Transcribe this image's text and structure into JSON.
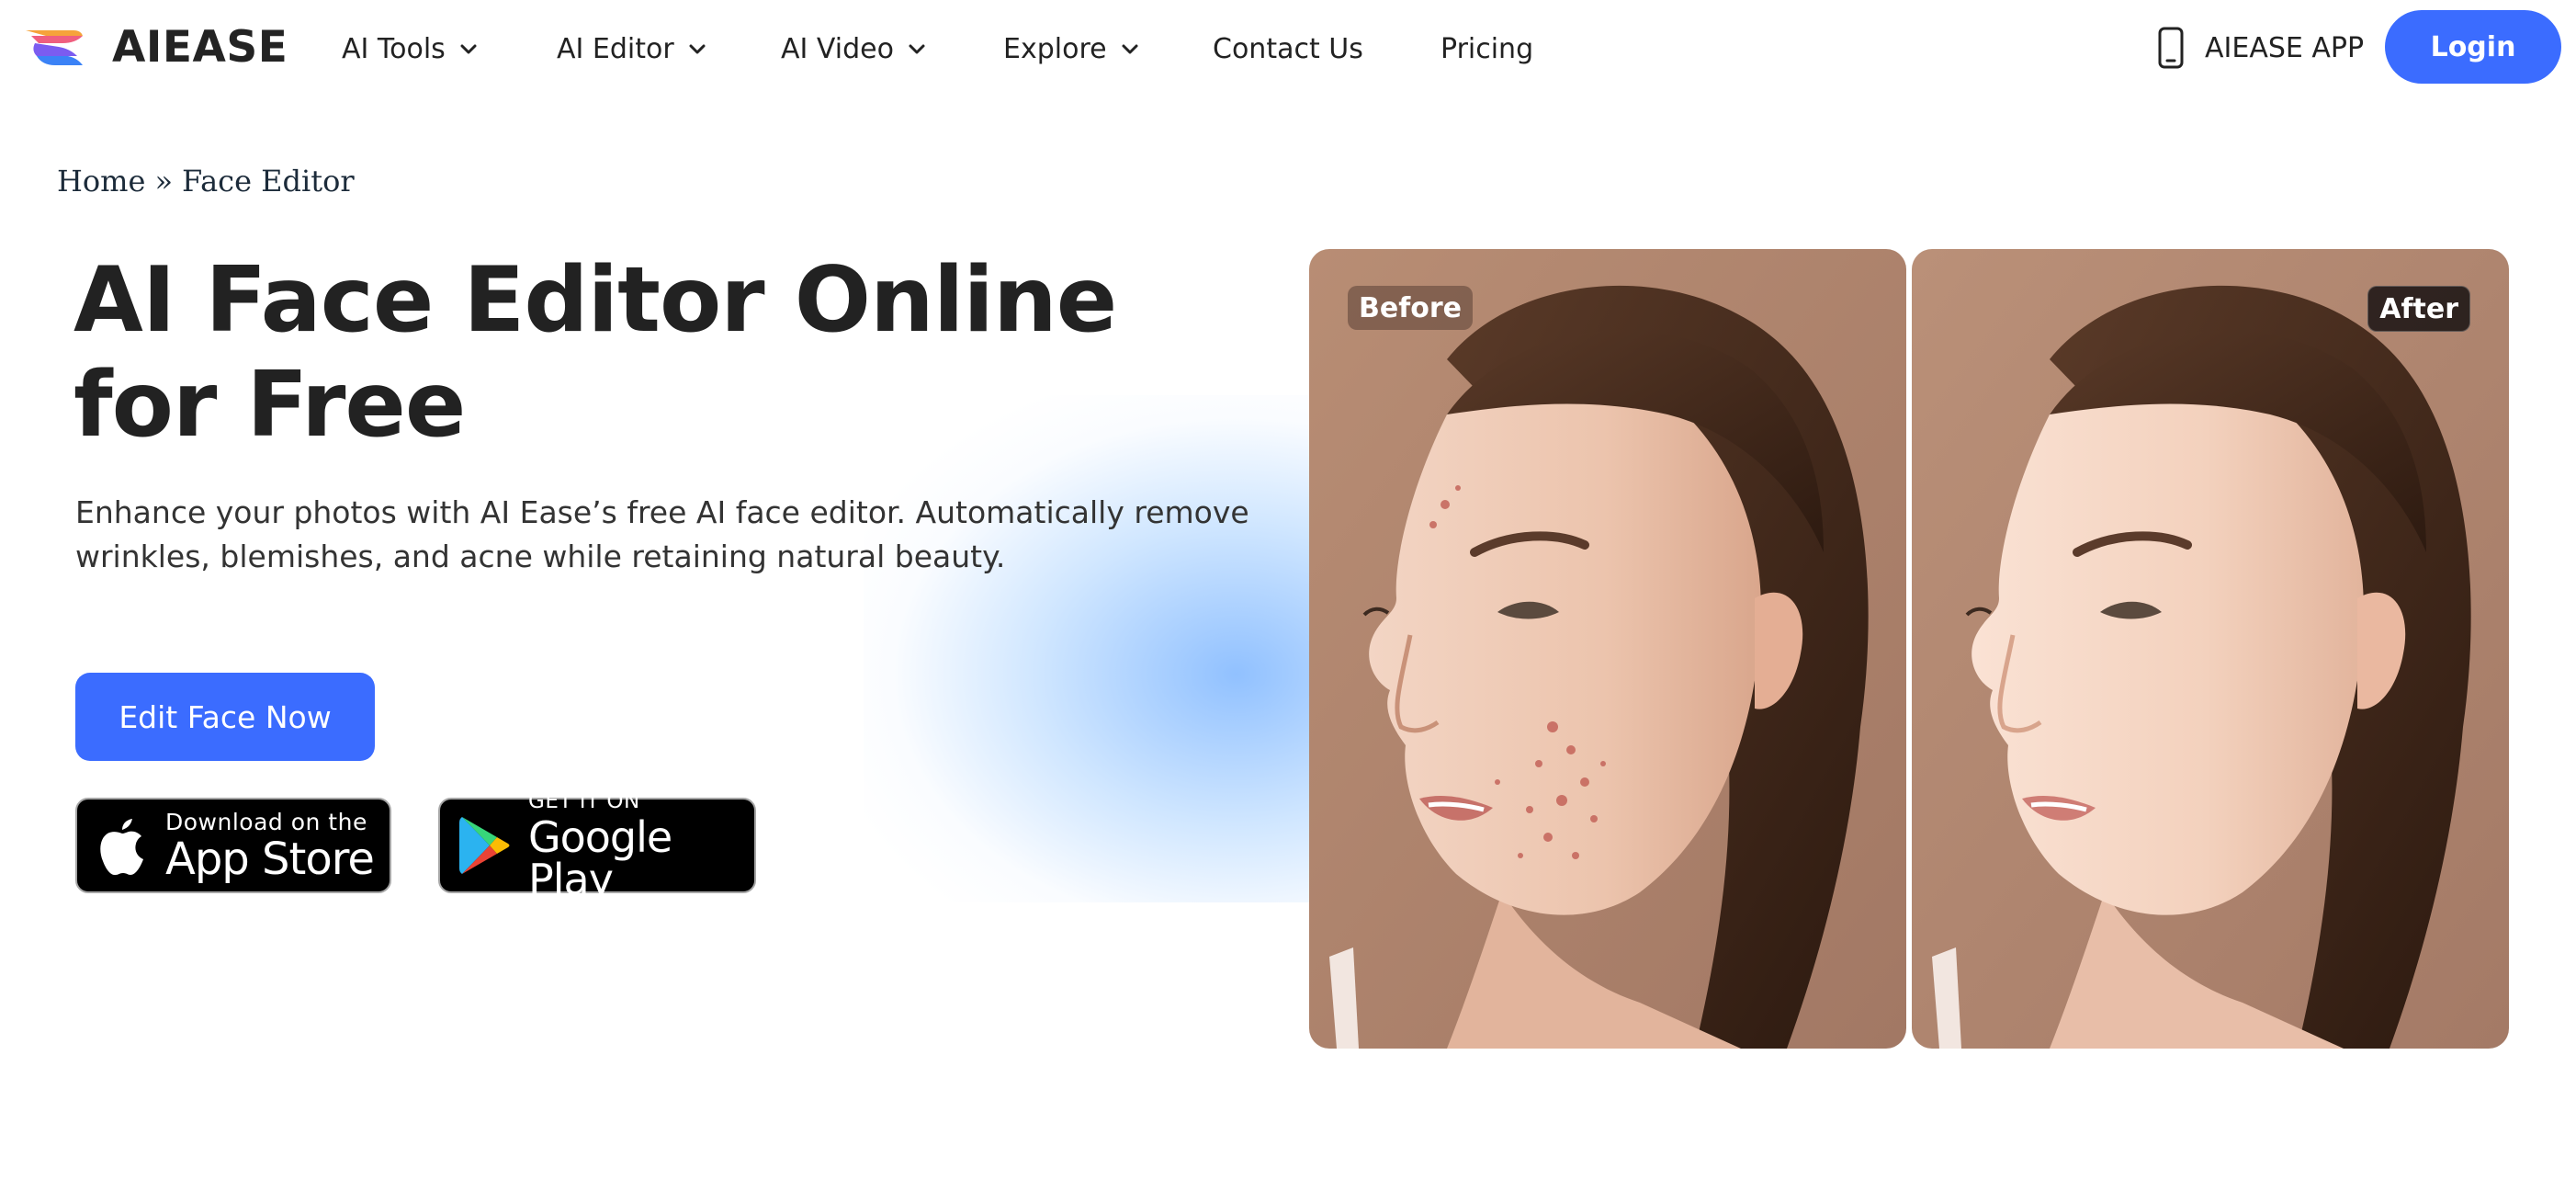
{
  "header": {
    "logo_text": "AIEASE",
    "nav": [
      {
        "label": "AI Tools",
        "has_dropdown": true
      },
      {
        "label": "AI Editor",
        "has_dropdown": true
      },
      {
        "label": "AI Video",
        "has_dropdown": true
      },
      {
        "label": "Explore",
        "has_dropdown": true
      },
      {
        "label": "Contact Us",
        "has_dropdown": false
      },
      {
        "label": "Pricing",
        "has_dropdown": false
      }
    ],
    "app_label": "AIEASE APP",
    "app_icon": "phone-icon",
    "login_label": "Login"
  },
  "breadcrumb": {
    "home": "Home",
    "separator": "»",
    "current": "Face Editor"
  },
  "hero": {
    "title": "AI Face Editor Online for Free",
    "description": "Enhance your photos with AI Ease’s free AI face editor. Automatically remove wrinkles, blemishes, and acne while retaining natural beauty.",
    "cta_label": "Edit Face Now"
  },
  "stores": {
    "apple": {
      "small": "Download on the",
      "big": "App Store",
      "icon": "apple-icon"
    },
    "google": {
      "small": "GET IT ON",
      "big": "Google Play",
      "icon": "google-play-icon"
    }
  },
  "comparison": {
    "before_label": "Before",
    "after_label": "After"
  },
  "colors": {
    "accent": "#3b6cff",
    "text": "#222222",
    "glow": "#7fb6ff"
  }
}
